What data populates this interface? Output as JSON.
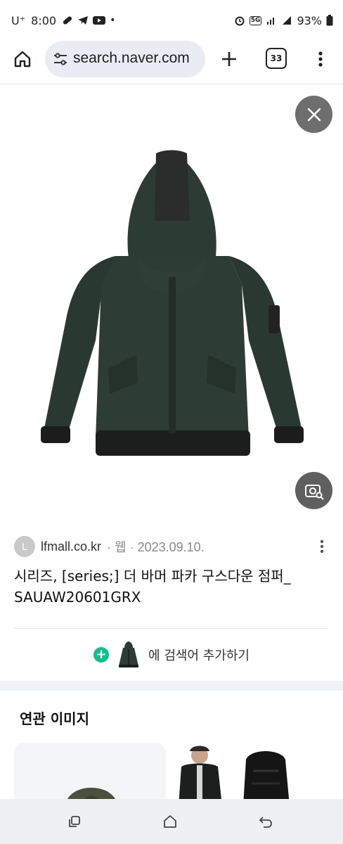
{
  "status_bar": {
    "carrier": "U⁺",
    "time": "8:00",
    "dot": "•",
    "network": "5G",
    "battery": "93%"
  },
  "toolbar": {
    "url": "search.naver.com",
    "tab_count": "33"
  },
  "result": {
    "favicon_letter": "L",
    "domain": "lfmall.co.kr",
    "meta": "· 웹 · 2023.09.10.",
    "title": "시리즈, [series;] 더 바머 파카 구스다운 점퍼_ SAUAW20601GRX"
  },
  "add_query": {
    "label": "에 검색어 추가하기"
  },
  "related": {
    "title": "연관 이미지"
  },
  "colors": {
    "jacket": "#2b3a33",
    "accent_green": "#10c08d",
    "fab_gray": "#6e6e6e",
    "url_bar_bg": "#e9ecf2",
    "nav_bg": "#eff0f4"
  }
}
